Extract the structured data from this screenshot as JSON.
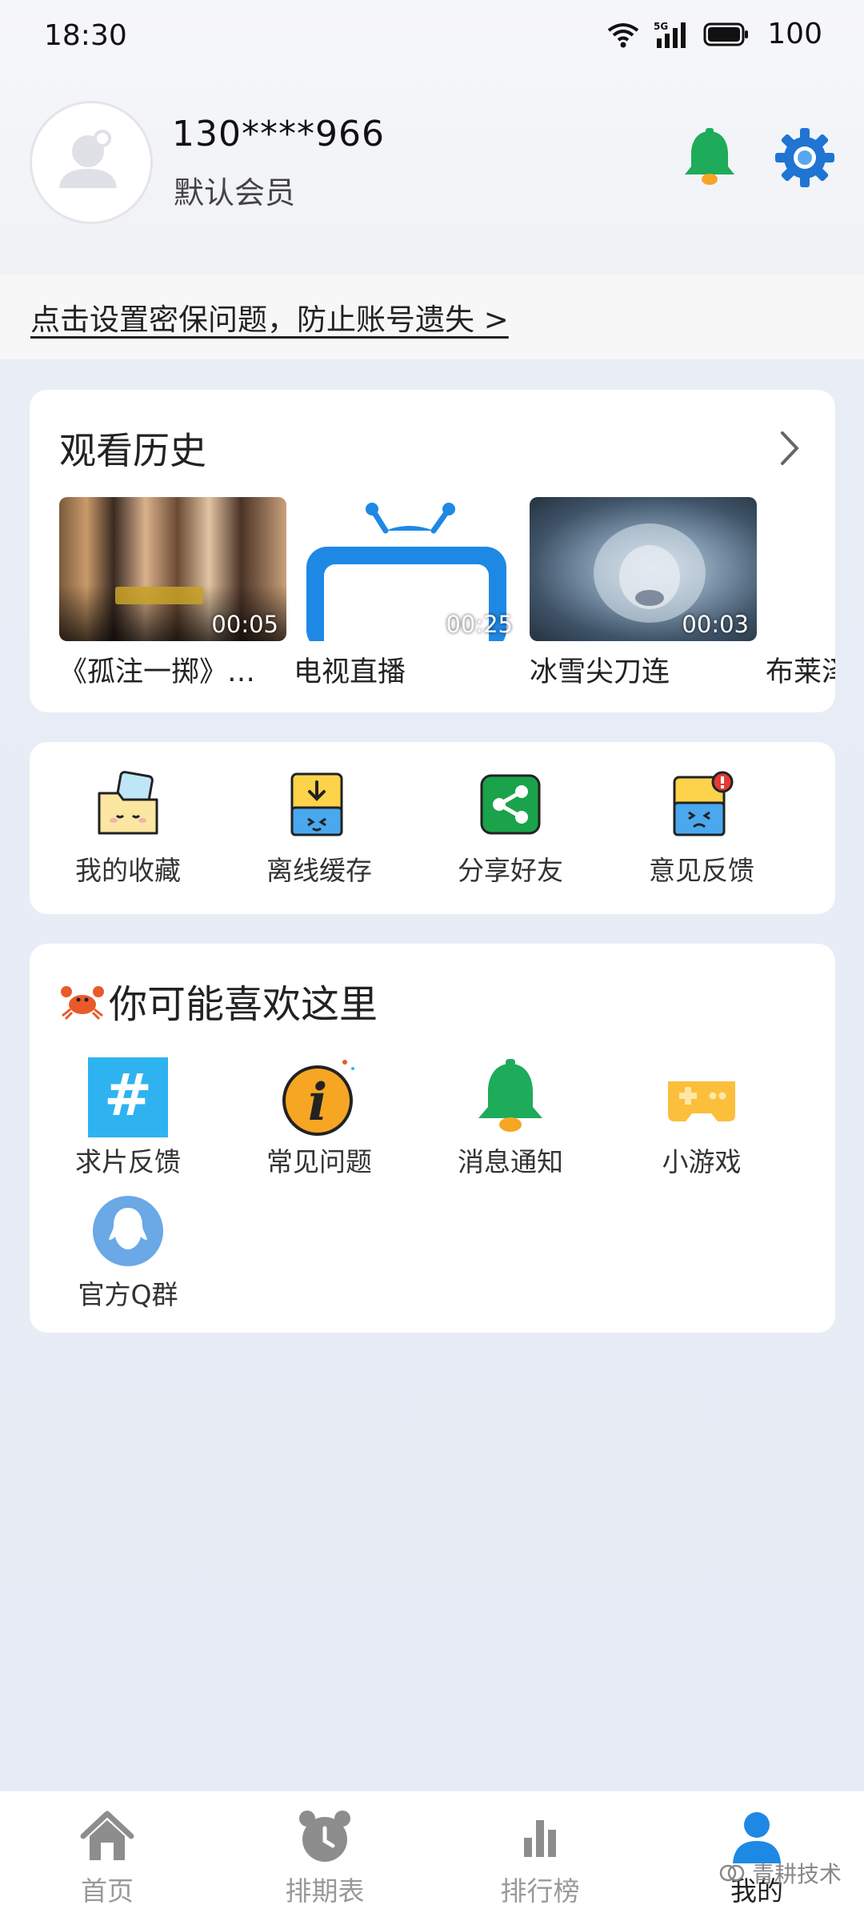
{
  "status_bar": {
    "time": "18:30",
    "network": "5G",
    "battery": "100"
  },
  "profile": {
    "username": "130****966",
    "member_level": "默认会员"
  },
  "security_banner": {
    "text": "点击设置密保问题，防止账号遗失 >"
  },
  "history": {
    "title": "观看历史",
    "items": [
      {
        "name": "《孤注一掷》…",
        "duration": "00:05"
      },
      {
        "name": "电视直播",
        "duration": "00:25"
      },
      {
        "name": "冰雪尖刀连",
        "duration": "00:03"
      },
      {
        "name": "布莱泽",
        "duration": ""
      }
    ]
  },
  "tools": [
    {
      "label": "我的收藏",
      "icon": "favorites-folder-icon"
    },
    {
      "label": "离线缓存",
      "icon": "offline-download-icon"
    },
    {
      "label": "分享好友",
      "icon": "share-icon"
    },
    {
      "label": "意见反馈",
      "icon": "feedback-icon"
    }
  ],
  "recommend": {
    "title": "你可能喜欢这里",
    "items": [
      {
        "label": "求片反馈",
        "icon": "hashtag-icon"
      },
      {
        "label": "常见问题",
        "icon": "info-icon"
      },
      {
        "label": "消息通知",
        "icon": "bell-icon"
      },
      {
        "label": "小游戏",
        "icon": "gamepad-icon"
      },
      {
        "label": "官方Q群",
        "icon": "qq-icon"
      }
    ]
  },
  "bottom_nav": [
    {
      "label": "首页",
      "icon": "home-icon",
      "active": false
    },
    {
      "label": "排期表",
      "icon": "alarm-clock-icon",
      "active": false
    },
    {
      "label": "排行榜",
      "icon": "bar-chart-icon",
      "active": false
    },
    {
      "label": "我的",
      "icon": "user-icon",
      "active": true
    }
  ],
  "watermark": "青耕技术",
  "colors": {
    "accent_blue": "#1e88e5",
    "bell_green": "#1eab5a",
    "gear_blue": "#1f75d1"
  }
}
